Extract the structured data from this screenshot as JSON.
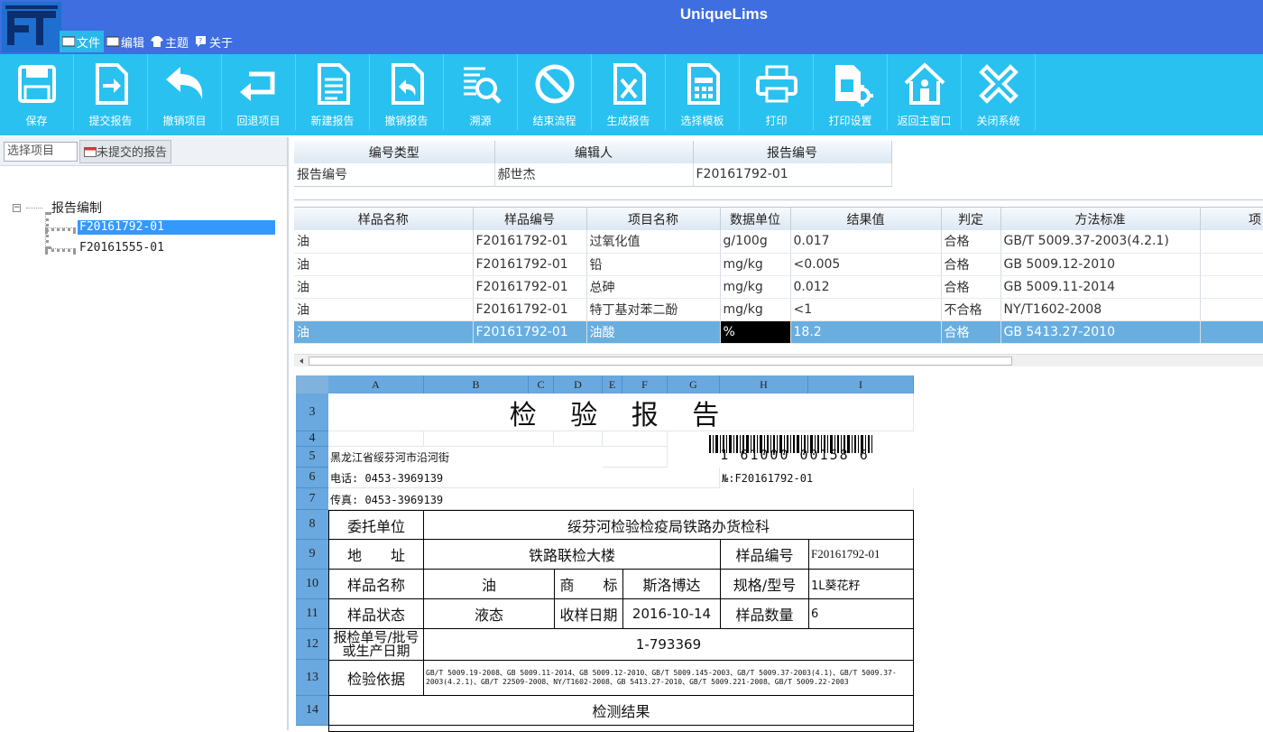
{
  "app": {
    "title": "UniqueLims"
  },
  "menu": [
    {
      "label": "文件"
    },
    {
      "label": "编辑"
    },
    {
      "label": "主题"
    },
    {
      "label": "关于"
    }
  ],
  "toolbar": [
    {
      "label": "保存",
      "icon": "save-icon"
    },
    {
      "label": "提交报告",
      "icon": "submit-icon"
    },
    {
      "label": "撤销项目",
      "icon": "undo-icon"
    },
    {
      "label": "回退项目",
      "icon": "return-icon"
    },
    {
      "label": "新建报告",
      "icon": "new-doc-icon"
    },
    {
      "label": "撤销报告",
      "icon": "doc-undo-icon"
    },
    {
      "label": "溯源",
      "icon": "trace-icon"
    },
    {
      "label": "结束流程",
      "icon": "stop-icon"
    },
    {
      "label": "生成报告",
      "icon": "excel-icon"
    },
    {
      "label": "选择模板",
      "icon": "template-icon"
    },
    {
      "label": "打印",
      "icon": "printer-icon"
    },
    {
      "label": "打印设置",
      "icon": "print-settings-icon"
    },
    {
      "label": "返回主窗口",
      "icon": "home-icon"
    },
    {
      "label": "关闭系统",
      "icon": "close-icon"
    }
  ],
  "left": {
    "select_placeholder": "选择项目",
    "unsubmitted_tab": "未提交的报告",
    "tree_root": "报告编制",
    "tree_items": [
      "F20161792-01",
      "F20161555-01"
    ]
  },
  "numgrid": {
    "headers": [
      "编号类型",
      "编辑人",
      "报告编号"
    ],
    "row": [
      "报告编号",
      "郝世杰",
      "F20161792-01"
    ]
  },
  "results": {
    "headers": [
      "样品名称",
      "样品编号",
      "项目名称",
      "数据单位",
      "结果值",
      "判定",
      "方法标准",
      "项目"
    ],
    "rows": [
      [
        "油",
        "F20161792-01",
        "过氧化值",
        "g/100g",
        "0.017",
        "合格",
        "GB/T 5009.37-2003(4.2.1)",
        ""
      ],
      [
        "油",
        "F20161792-01",
        "铅",
        "mg/kg",
        "<0.005",
        "合格",
        "GB 5009.12-2010",
        ""
      ],
      [
        "油",
        "F20161792-01",
        "总砷",
        "mg/kg",
        "0.012",
        "合格",
        "GB 5009.11-2014",
        ""
      ],
      [
        "油",
        "F20161792-01",
        "特丁基对苯二酚",
        "mg/kg",
        "<1",
        "不合格",
        "NY/T1602-2008",
        ""
      ],
      [
        "油",
        "F20161792-01",
        "油酸",
        "%",
        "18.2",
        "合格",
        "GB 5413.27-2010",
        ""
      ]
    ]
  },
  "sheet": {
    "columns": [
      "A",
      "B",
      "C",
      "D",
      "E",
      "F",
      "G",
      "H",
      "I"
    ],
    "rows": [
      "3",
      "4",
      "5",
      "6",
      "7",
      "8",
      "9",
      "10",
      "11",
      "12",
      "13",
      "14"
    ],
    "title": "检 验 报 告",
    "barcode_text": "1 61000 00158 6",
    "address": "黑龙江省绥芬河市沿河街",
    "phone": "电话: 0453-3969139",
    "fax": "传真: 0453-3969139",
    "report_no": "№:F20161792-01",
    "client_label": "委托单位",
    "client_value": "绥芬河检验检疫局铁路办货检科",
    "address_label": "地　　址",
    "address_value": "铁路联检大楼",
    "sample_no_label": "样品编号",
    "sample_no_value": "F20161792-01",
    "sample_name_label": "样品名称",
    "sample_name_value": "油",
    "brand_label": "商　　标",
    "brand_value": "斯洛博达",
    "spec_label": "规格/型号",
    "spec_value": "1L葵花籽",
    "state_label": "样品状态",
    "state_value": "液态",
    "received_label": "收样日期",
    "received_value": "2016-10-14",
    "qty_label": "样品数量",
    "qty_value": "6",
    "batch_label": "报检单号/批号或生产日期",
    "batch_value": "1-793369",
    "basis_label": "检验依据",
    "basis_value": "GB/T 5009.19-2008、GB 5009.11-2014、GB 5009.12-2010、GB/T 5009.145-2003、GB/T 5009.37-2003(4.1)、GB/T 5009.37-2003(4.2.1)、GB/T 22509-2008、NY/T1602-2008、GB 5413.27-2010、GB/T 5009.221-2008、GB/T 5009.22-2003",
    "results_title": "检测结果"
  }
}
